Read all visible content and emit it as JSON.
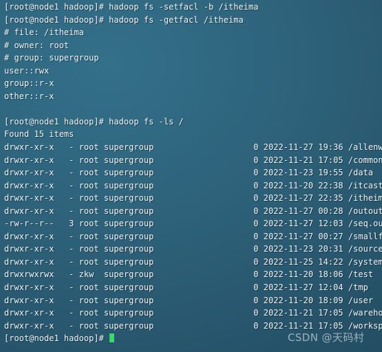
{
  "terminal": {
    "prompt": "[root@node1 hadoop]# ",
    "colors": {
      "background": "#2d6179",
      "foreground": "#f2f4f5",
      "cursor": "#2fe05c"
    },
    "cursor_visible": true
  },
  "watermark": {
    "text": "CSDN @天码村"
  },
  "session": {
    "commands": [
      {
        "prompt": "[root@node1 hadoop]# ",
        "command": "hadoop fs -setfacl -b /itheima"
      },
      {
        "prompt": "[root@node1 hadoop]# ",
        "command": "hadoop fs -getfacl /itheima"
      },
      {
        "prompt": "[root@node1 hadoop]# ",
        "command": "hadoop fs -ls /"
      },
      {
        "prompt": "[root@node1 hadoop]# ",
        "command": ""
      }
    ],
    "getfacl_output": [
      "# file: /itheima",
      "# owner: root",
      "# group: supergroup",
      "user::rwx",
      "group::r-x",
      "other::r-x"
    ],
    "ls_header": "Found 15 items",
    "ls_rows": [
      {
        "perms": "drwxr-xr-x",
        "replication": "-",
        "owner": "root",
        "group": "supergroup",
        "size": "0",
        "date": "2022-11-27",
        "time": "19:36",
        "path": "/allenwoon"
      },
      {
        "perms": "drwxr-xr-x",
        "replication": "-",
        "owner": "root",
        "group": "supergroup",
        "size": "0",
        "date": "2022-11-21",
        "time": "17:05",
        "path": "/common"
      },
      {
        "perms": "drwxr-xr-x",
        "replication": "-",
        "owner": "root",
        "group": "supergroup",
        "size": "0",
        "date": "2022-11-23",
        "time": "19:55",
        "path": "/data"
      },
      {
        "perms": "drwxr-xr-x",
        "replication": "-",
        "owner": "root",
        "group": "supergroup",
        "size": "0",
        "date": "2022-11-20",
        "time": "22:38",
        "path": "/itcast"
      },
      {
        "perms": "drwxr-xr-x",
        "replication": "-",
        "owner": "root",
        "group": "supergroup",
        "size": "0",
        "date": "2022-11-27",
        "time": "22:35",
        "path": "/itheima"
      },
      {
        "perms": "drwxr-xr-x",
        "replication": "-",
        "owner": "root",
        "group": "supergroup",
        "size": "0",
        "date": "2022-11-27",
        "time": "00:28",
        "path": "/outoutdir"
      },
      {
        "perms": "-rw-r--r--",
        "replication": "3",
        "owner": "root",
        "group": "supergroup",
        "size": "0",
        "date": "2022-11-27",
        "time": "12:03",
        "path": "/seq.out"
      },
      {
        "perms": "drwxr-xr-x",
        "replication": "-",
        "owner": "root",
        "group": "supergroup",
        "size": "0",
        "date": "2022-11-27",
        "time": "00:27",
        "path": "/smallfile"
      },
      {
        "perms": "drwxr-xr-x",
        "replication": "-",
        "owner": "root",
        "group": "supergroup",
        "size": "0",
        "date": "2022-11-23",
        "time": "20:31",
        "path": "/source"
      },
      {
        "perms": "drwxr-xr-x",
        "replication": "-",
        "owner": "root",
        "group": "supergroup",
        "size": "0",
        "date": "2022-11-25",
        "time": "14:22",
        "path": "/system"
      },
      {
        "perms": "drwxrwxrwx",
        "replication": "-",
        "owner": "zkw",
        "group": "supergroup",
        "size": "0",
        "date": "2022-11-20",
        "time": "18:06",
        "path": "/test"
      },
      {
        "perms": "drwxr-xr-x",
        "replication": "-",
        "owner": "root",
        "group": "supergroup",
        "size": "0",
        "date": "2022-11-27",
        "time": "12:04",
        "path": "/tmp"
      },
      {
        "perms": "drwxr-xr-x",
        "replication": "-",
        "owner": "root",
        "group": "supergroup",
        "size": "0",
        "date": "2022-11-20",
        "time": "18:09",
        "path": "/user"
      },
      {
        "perms": "drwxr-xr-x",
        "replication": "-",
        "owner": "root",
        "group": "supergroup",
        "size": "0",
        "date": "2022-11-21",
        "time": "17:05",
        "path": "/warehouse"
      },
      {
        "perms": "drwxr-xr-x",
        "replication": "-",
        "owner": "root",
        "group": "supergroup",
        "size": "0",
        "date": "2022-11-21",
        "time": "17:05",
        "path": "/workspace"
      }
    ]
  }
}
